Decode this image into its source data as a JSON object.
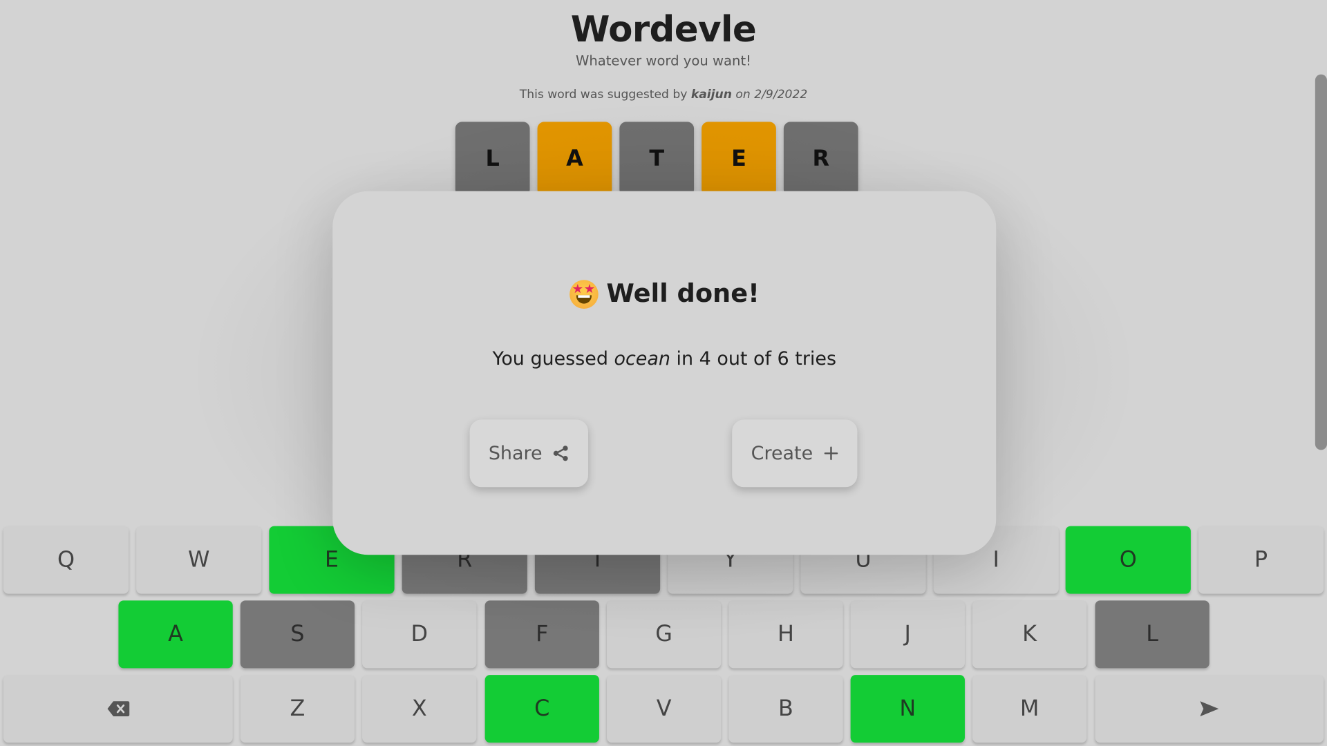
{
  "header": {
    "title": "Wordevle",
    "subtitle": "Whatever word you want!",
    "credit_prefix": "This word was suggested by",
    "credit_user": "kaijun",
    "credit_on": "on",
    "credit_date": "2/9/2022"
  },
  "guess_row": [
    {
      "letter": "L",
      "state": "absent"
    },
    {
      "letter": "A",
      "state": "present"
    },
    {
      "letter": "T",
      "state": "absent"
    },
    {
      "letter": "E",
      "state": "present"
    },
    {
      "letter": "R",
      "state": "absent"
    }
  ],
  "modal": {
    "emoji": "star-struck-emoji",
    "title": "Well done!",
    "msg_before": "You guessed",
    "word": "ocean",
    "msg_after": "in 4 out of 6 tries",
    "share_label": "Share",
    "share_icon": "share-icon",
    "create_label": "Create",
    "create_icon": "plus-icon"
  },
  "keyboard": {
    "row1": [
      {
        "key": "Q",
        "state": "unused"
      },
      {
        "key": "W",
        "state": "unused"
      },
      {
        "key": "E",
        "state": "correct"
      },
      {
        "key": "R",
        "state": "absent"
      },
      {
        "key": "T",
        "state": "absent"
      },
      {
        "key": "Y",
        "state": "unused"
      },
      {
        "key": "U",
        "state": "unused"
      },
      {
        "key": "I",
        "state": "unused"
      },
      {
        "key": "O",
        "state": "correct"
      },
      {
        "key": "P",
        "state": "unused"
      }
    ],
    "row2": [
      {
        "key": "A",
        "state": "correct"
      },
      {
        "key": "S",
        "state": "absent"
      },
      {
        "key": "D",
        "state": "unused"
      },
      {
        "key": "F",
        "state": "absent"
      },
      {
        "key": "G",
        "state": "unused"
      },
      {
        "key": "H",
        "state": "unused"
      },
      {
        "key": "J",
        "state": "unused"
      },
      {
        "key": "K",
        "state": "unused"
      },
      {
        "key": "L",
        "state": "absent"
      }
    ],
    "row3": [
      {
        "key": "",
        "icon": "backspace-icon",
        "state": "unused"
      },
      {
        "key": "Z",
        "state": "unused"
      },
      {
        "key": "X",
        "state": "unused"
      },
      {
        "key": "C",
        "state": "correct"
      },
      {
        "key": "V",
        "state": "unused"
      },
      {
        "key": "B",
        "state": "unused"
      },
      {
        "key": "N",
        "state": "correct"
      },
      {
        "key": "M",
        "state": "unused"
      },
      {
        "key": "",
        "icon": "enter-arrow-icon",
        "state": "unused"
      }
    ]
  },
  "colors": {
    "background": "#d3d3d3",
    "correct": "#13cc35",
    "present": "#e39600",
    "absent": "#777777",
    "unused": "#cfcfcf"
  }
}
